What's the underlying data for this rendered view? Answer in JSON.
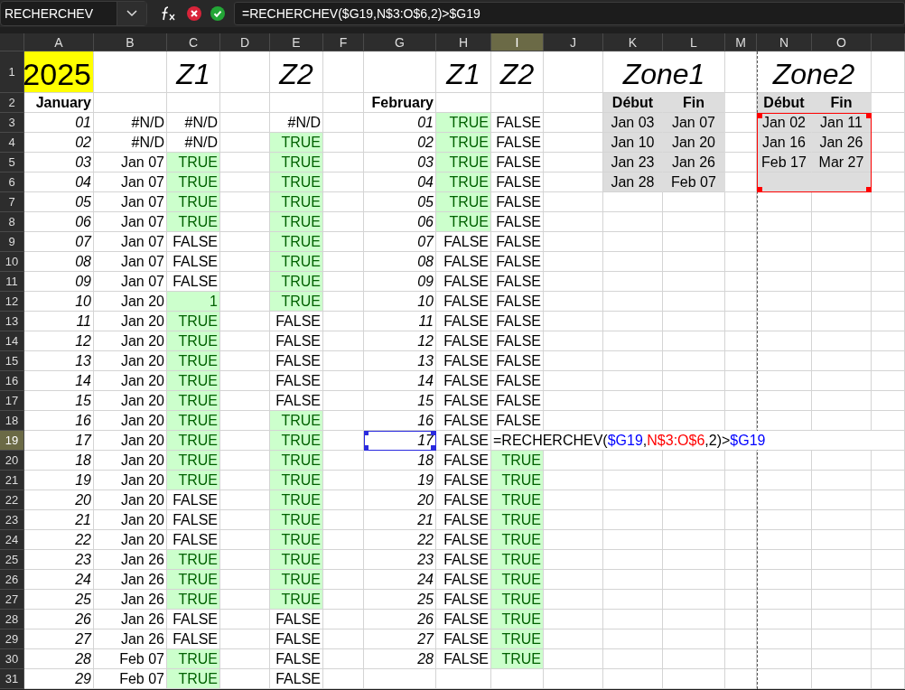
{
  "name_box": {
    "value": "RECHERCHEV"
  },
  "formula_bar": {
    "value": "=RECHERCHEV($G19,N$3:O$6,2)>$G19"
  },
  "columns": [
    {
      "label": "A",
      "selected": false,
      "page_break_before": false
    },
    {
      "label": "B",
      "selected": false,
      "page_break_before": false
    },
    {
      "label": "C",
      "selected": false,
      "page_break_before": false
    },
    {
      "label": "D",
      "selected": false,
      "page_break_before": false
    },
    {
      "label": "E",
      "selected": false,
      "page_break_before": false
    },
    {
      "label": "F",
      "selected": false,
      "page_break_before": false
    },
    {
      "label": "G",
      "selected": false,
      "page_break_before": false
    },
    {
      "label": "H",
      "selected": false,
      "page_break_before": false
    },
    {
      "label": "I",
      "selected": true,
      "page_break_before": false
    },
    {
      "label": "J",
      "selected": false,
      "page_break_before": false
    },
    {
      "label": "K",
      "selected": false,
      "page_break_before": false
    },
    {
      "label": "L",
      "selected": false,
      "page_break_before": false
    },
    {
      "label": "M",
      "selected": false,
      "page_break_before": false
    },
    {
      "label": "N",
      "selected": false,
      "page_break_before": true
    },
    {
      "label": "O",
      "selected": false,
      "page_break_before": false
    }
  ],
  "rows": [
    {
      "num": "1",
      "selected": false,
      "cells": [
        {
          "kind": "year",
          "text": "2025"
        },
        null,
        {
          "kind": "title",
          "text": "Z1"
        },
        null,
        {
          "kind": "title",
          "text": "Z2"
        },
        null,
        null,
        {
          "kind": "title",
          "text": "Z1"
        },
        {
          "kind": "title",
          "text": "Z2"
        },
        null,
        {
          "kind": "wide_title",
          "text": "Zone1"
        },
        null,
        null,
        {
          "kind": "wide_title",
          "text": "Zone2"
        },
        null
      ]
    },
    {
      "num": "2",
      "selected": false,
      "cells": [
        {
          "kind": "month",
          "text": "January"
        },
        null,
        null,
        null,
        null,
        null,
        {
          "kind": "month",
          "text": "February"
        },
        null,
        null,
        null,
        {
          "kind": "head",
          "text": "Début"
        },
        {
          "kind": "head",
          "text": "Fin"
        },
        null,
        {
          "kind": "head",
          "text": "Début"
        },
        {
          "kind": "head",
          "text": "Fin"
        }
      ]
    },
    {
      "num": "3",
      "selected": false,
      "cells": [
        {
          "kind": "day",
          "text": "01"
        },
        {
          "kind": "value",
          "text": "#N/D"
        },
        {
          "kind": "bool",
          "text": "#N/D",
          "highlighted": false
        },
        null,
        {
          "kind": "bool",
          "text": "#N/D",
          "highlighted": false
        },
        null,
        {
          "kind": "day",
          "text": "01"
        },
        {
          "kind": "bool",
          "text": "TRUE",
          "highlighted": true
        },
        {
          "kind": "bool",
          "text": "FALSE",
          "highlighted": false
        },
        null,
        {
          "kind": "range",
          "text": "Jan 03",
          "referenced": false
        },
        {
          "kind": "range",
          "text": "Jan 07",
          "referenced": false
        },
        null,
        {
          "kind": "range",
          "text": "Jan 02",
          "referenced": true
        },
        {
          "kind": "range",
          "text": "Jan 11",
          "referenced": true
        }
      ]
    },
    {
      "num": "4",
      "selected": false,
      "cells": [
        {
          "kind": "day",
          "text": "02"
        },
        {
          "kind": "value",
          "text": "#N/D"
        },
        {
          "kind": "bool",
          "text": "#N/D",
          "highlighted": false
        },
        null,
        {
          "kind": "bool",
          "text": "TRUE",
          "highlighted": true
        },
        null,
        {
          "kind": "day",
          "text": "02"
        },
        {
          "kind": "bool",
          "text": "TRUE",
          "highlighted": true
        },
        {
          "kind": "bool",
          "text": "FALSE",
          "highlighted": false
        },
        null,
        {
          "kind": "range",
          "text": "Jan 10",
          "referenced": false
        },
        {
          "kind": "range",
          "text": "Jan 20",
          "referenced": false
        },
        null,
        {
          "kind": "range",
          "text": "Jan 16",
          "referenced": true
        },
        {
          "kind": "range",
          "text": "Jan 26",
          "referenced": true
        }
      ]
    },
    {
      "num": "5",
      "selected": false,
      "cells": [
        {
          "kind": "day",
          "text": "03"
        },
        {
          "kind": "value",
          "text": "Jan 07"
        },
        {
          "kind": "bool",
          "text": "TRUE",
          "highlighted": true
        },
        null,
        {
          "kind": "bool",
          "text": "TRUE",
          "highlighted": true
        },
        null,
        {
          "kind": "day",
          "text": "03"
        },
        {
          "kind": "bool",
          "text": "TRUE",
          "highlighted": true
        },
        {
          "kind": "bool",
          "text": "FALSE",
          "highlighted": false
        },
        null,
        {
          "kind": "range",
          "text": "Jan 23",
          "referenced": false
        },
        {
          "kind": "range",
          "text": "Jan 26",
          "referenced": false
        },
        null,
        {
          "kind": "range",
          "text": "Feb 17",
          "referenced": true
        },
        {
          "kind": "range",
          "text": "Mar 27",
          "referenced": true
        }
      ]
    },
    {
      "num": "6",
      "selected": false,
      "cells": [
        {
          "kind": "day",
          "text": "04"
        },
        {
          "kind": "value",
          "text": "Jan 07"
        },
        {
          "kind": "bool",
          "text": "TRUE",
          "highlighted": true
        },
        null,
        {
          "kind": "bool",
          "text": "TRUE",
          "highlighted": true
        },
        null,
        {
          "kind": "day",
          "text": "04"
        },
        {
          "kind": "bool",
          "text": "TRUE",
          "highlighted": true
        },
        {
          "kind": "bool",
          "text": "FALSE",
          "highlighted": false
        },
        null,
        {
          "kind": "range",
          "text": "Jan 28",
          "referenced": false
        },
        {
          "kind": "range",
          "text": "Feb 07",
          "referenced": false
        },
        null,
        {
          "kind": "range",
          "referenced": true
        },
        {
          "kind": "range",
          "referenced": true
        }
      ]
    },
    {
      "num": "7",
      "selected": false,
      "cells": [
        {
          "kind": "day",
          "text": "05"
        },
        {
          "kind": "value",
          "text": "Jan 07"
        },
        {
          "kind": "bool",
          "text": "TRUE",
          "highlighted": true
        },
        null,
        {
          "kind": "bool",
          "text": "TRUE",
          "highlighted": true
        },
        null,
        {
          "kind": "day",
          "text": "05"
        },
        {
          "kind": "bool",
          "text": "TRUE",
          "highlighted": true
        },
        {
          "kind": "bool",
          "text": "FALSE",
          "highlighted": false
        }
      ]
    },
    {
      "num": "8",
      "selected": false,
      "cells": [
        {
          "kind": "day",
          "text": "06"
        },
        {
          "kind": "value",
          "text": "Jan 07"
        },
        {
          "kind": "bool",
          "text": "TRUE",
          "highlighted": true
        },
        null,
        {
          "kind": "bool",
          "text": "TRUE",
          "highlighted": true
        },
        null,
        {
          "kind": "day",
          "text": "06"
        },
        {
          "kind": "bool",
          "text": "TRUE",
          "highlighted": true
        },
        {
          "kind": "bool",
          "text": "FALSE",
          "highlighted": false
        }
      ]
    },
    {
      "num": "9",
      "selected": false,
      "cells": [
        {
          "kind": "day",
          "text": "07"
        },
        {
          "kind": "value",
          "text": "Jan 07"
        },
        {
          "kind": "bool",
          "text": "FALSE",
          "highlighted": false
        },
        null,
        {
          "kind": "bool",
          "text": "TRUE",
          "highlighted": true
        },
        null,
        {
          "kind": "day",
          "text": "07"
        },
        {
          "kind": "bool",
          "text": "FALSE",
          "highlighted": false
        },
        {
          "kind": "bool",
          "text": "FALSE",
          "highlighted": false
        }
      ]
    },
    {
      "num": "10",
      "selected": false,
      "cells": [
        {
          "kind": "day",
          "text": "08"
        },
        {
          "kind": "value",
          "text": "Jan 07"
        },
        {
          "kind": "bool",
          "text": "FALSE",
          "highlighted": false
        },
        null,
        {
          "kind": "bool",
          "text": "TRUE",
          "highlighted": true
        },
        null,
        {
          "kind": "day",
          "text": "08"
        },
        {
          "kind": "bool",
          "text": "FALSE",
          "highlighted": false
        },
        {
          "kind": "bool",
          "text": "FALSE",
          "highlighted": false
        }
      ]
    },
    {
      "num": "11",
      "selected": false,
      "cells": [
        {
          "kind": "day",
          "text": "09"
        },
        {
          "kind": "value",
          "text": "Jan 07"
        },
        {
          "kind": "bool",
          "text": "FALSE",
          "highlighted": false
        },
        null,
        {
          "kind": "bool",
          "text": "TRUE",
          "highlighted": true
        },
        null,
        {
          "kind": "day",
          "text": "09"
        },
        {
          "kind": "bool",
          "text": "FALSE",
          "highlighted": false
        },
        {
          "kind": "bool",
          "text": "FALSE",
          "highlighted": false
        }
      ]
    },
    {
      "num": "12",
      "selected": false,
      "cells": [
        {
          "kind": "day",
          "text": "10"
        },
        {
          "kind": "value",
          "text": "Jan 20"
        },
        {
          "kind": "bool",
          "text": "1",
          "highlighted": true
        },
        null,
        {
          "kind": "bool",
          "text": "TRUE",
          "highlighted": true
        },
        null,
        {
          "kind": "day",
          "text": "10"
        },
        {
          "kind": "bool",
          "text": "FALSE",
          "highlighted": false
        },
        {
          "kind": "bool",
          "text": "FALSE",
          "highlighted": false
        }
      ]
    },
    {
      "num": "13",
      "selected": false,
      "cells": [
        {
          "kind": "day",
          "text": "11"
        },
        {
          "kind": "value",
          "text": "Jan 20"
        },
        {
          "kind": "bool",
          "text": "TRUE",
          "highlighted": true
        },
        null,
        {
          "kind": "bool",
          "text": "FALSE",
          "highlighted": false
        },
        null,
        {
          "kind": "day",
          "text": "11"
        },
        {
          "kind": "bool",
          "text": "FALSE",
          "highlighted": false
        },
        {
          "kind": "bool",
          "text": "FALSE",
          "highlighted": false
        }
      ]
    },
    {
      "num": "14",
      "selected": false,
      "cells": [
        {
          "kind": "day",
          "text": "12"
        },
        {
          "kind": "value",
          "text": "Jan 20"
        },
        {
          "kind": "bool",
          "text": "TRUE",
          "highlighted": true
        },
        null,
        {
          "kind": "bool",
          "text": "FALSE",
          "highlighted": false
        },
        null,
        {
          "kind": "day",
          "text": "12"
        },
        {
          "kind": "bool",
          "text": "FALSE",
          "highlighted": false
        },
        {
          "kind": "bool",
          "text": "FALSE",
          "highlighted": false
        }
      ]
    },
    {
      "num": "15",
      "selected": false,
      "cells": [
        {
          "kind": "day",
          "text": "13"
        },
        {
          "kind": "value",
          "text": "Jan 20"
        },
        {
          "kind": "bool",
          "text": "TRUE",
          "highlighted": true
        },
        null,
        {
          "kind": "bool",
          "text": "FALSE",
          "highlighted": false
        },
        null,
        {
          "kind": "day",
          "text": "13"
        },
        {
          "kind": "bool",
          "text": "FALSE",
          "highlighted": false
        },
        {
          "kind": "bool",
          "text": "FALSE",
          "highlighted": false
        }
      ]
    },
    {
      "num": "16",
      "selected": false,
      "cells": [
        {
          "kind": "day",
          "text": "14"
        },
        {
          "kind": "value",
          "text": "Jan 20"
        },
        {
          "kind": "bool",
          "text": "TRUE",
          "highlighted": true
        },
        null,
        {
          "kind": "bool",
          "text": "FALSE",
          "highlighted": false
        },
        null,
        {
          "kind": "day",
          "text": "14"
        },
        {
          "kind": "bool",
          "text": "FALSE",
          "highlighted": false
        },
        {
          "kind": "bool",
          "text": "FALSE",
          "highlighted": false
        }
      ]
    },
    {
      "num": "17",
      "selected": false,
      "cells": [
        {
          "kind": "day",
          "text": "15"
        },
        {
          "kind": "value",
          "text": "Jan 20"
        },
        {
          "kind": "bool",
          "text": "TRUE",
          "highlighted": true
        },
        null,
        {
          "kind": "bool",
          "text": "FALSE",
          "highlighted": false
        },
        null,
        {
          "kind": "day",
          "text": "15"
        },
        {
          "kind": "bool",
          "text": "FALSE",
          "highlighted": false
        },
        {
          "kind": "bool",
          "text": "FALSE",
          "highlighted": false
        }
      ]
    },
    {
      "num": "18",
      "selected": false,
      "cells": [
        {
          "kind": "day",
          "text": "16"
        },
        {
          "kind": "value",
          "text": "Jan 20"
        },
        {
          "kind": "bool",
          "text": "TRUE",
          "highlighted": true
        },
        null,
        {
          "kind": "bool",
          "text": "TRUE",
          "highlighted": true
        },
        null,
        {
          "kind": "day",
          "text": "16"
        },
        {
          "kind": "bool",
          "text": "FALSE",
          "highlighted": false
        },
        {
          "kind": "bool",
          "text": "FALSE",
          "highlighted": false
        }
      ]
    },
    {
      "num": "19",
      "selected": true,
      "cells": [
        {
          "kind": "day",
          "text": "17"
        },
        {
          "kind": "value",
          "text": "Jan 20"
        },
        {
          "kind": "bool",
          "text": "TRUE",
          "highlighted": true
        },
        null,
        {
          "kind": "bool",
          "text": "TRUE",
          "highlighted": true
        },
        null,
        {
          "kind": "day",
          "text": "17",
          "selected": true
        },
        {
          "kind": "bool",
          "text": "FALSE",
          "highlighted": false
        },
        {
          "kind": "editor",
          "parts": [
            {
              "text": "=RECHERCHEV("
            },
            {
              "text": "$G19",
              "color": "#0000ff"
            },
            {
              "text": ","
            },
            {
              "text": "N$3:O$6",
              "color": "#ff0000"
            },
            {
              "text": ",2)>"
            },
            {
              "text": "$G19",
              "color": "#0000ff"
            }
          ]
        }
      ]
    },
    {
      "num": "20",
      "selected": false,
      "cells": [
        {
          "kind": "day",
          "text": "18"
        },
        {
          "kind": "value",
          "text": "Jan 20"
        },
        {
          "kind": "bool",
          "text": "TRUE",
          "highlighted": true
        },
        null,
        {
          "kind": "bool",
          "text": "TRUE",
          "highlighted": true
        },
        null,
        {
          "kind": "day",
          "text": "18"
        },
        {
          "kind": "bool",
          "text": "FALSE",
          "highlighted": false
        },
        {
          "kind": "bool",
          "text": "TRUE",
          "highlighted": true
        }
      ]
    },
    {
      "num": "21",
      "selected": false,
      "cells": [
        {
          "kind": "day",
          "text": "19"
        },
        {
          "kind": "value",
          "text": "Jan 20"
        },
        {
          "kind": "bool",
          "text": "TRUE",
          "highlighted": true
        },
        null,
        {
          "kind": "bool",
          "text": "TRUE",
          "highlighted": true
        },
        null,
        {
          "kind": "day",
          "text": "19"
        },
        {
          "kind": "bool",
          "text": "FALSE",
          "highlighted": false
        },
        {
          "kind": "bool",
          "text": "TRUE",
          "highlighted": true
        }
      ]
    },
    {
      "num": "22",
      "selected": false,
      "cells": [
        {
          "kind": "day",
          "text": "20"
        },
        {
          "kind": "value",
          "text": "Jan 20"
        },
        {
          "kind": "bool",
          "text": "FALSE",
          "highlighted": false
        },
        null,
        {
          "kind": "bool",
          "text": "TRUE",
          "highlighted": true
        },
        null,
        {
          "kind": "day",
          "text": "20"
        },
        {
          "kind": "bool",
          "text": "FALSE",
          "highlighted": false
        },
        {
          "kind": "bool",
          "text": "TRUE",
          "highlighted": true
        }
      ]
    },
    {
      "num": "23",
      "selected": false,
      "cells": [
        {
          "kind": "day",
          "text": "21"
        },
        {
          "kind": "value",
          "text": "Jan 20"
        },
        {
          "kind": "bool",
          "text": "FALSE",
          "highlighted": false
        },
        null,
        {
          "kind": "bool",
          "text": "TRUE",
          "highlighted": true
        },
        null,
        {
          "kind": "day",
          "text": "21"
        },
        {
          "kind": "bool",
          "text": "FALSE",
          "highlighted": false
        },
        {
          "kind": "bool",
          "text": "TRUE",
          "highlighted": true
        }
      ]
    },
    {
      "num": "24",
      "selected": false,
      "cells": [
        {
          "kind": "day",
          "text": "22"
        },
        {
          "kind": "value",
          "text": "Jan 20"
        },
        {
          "kind": "bool",
          "text": "FALSE",
          "highlighted": false
        },
        null,
        {
          "kind": "bool",
          "text": "TRUE",
          "highlighted": true
        },
        null,
        {
          "kind": "day",
          "text": "22"
        },
        {
          "kind": "bool",
          "text": "FALSE",
          "highlighted": false
        },
        {
          "kind": "bool",
          "text": "TRUE",
          "highlighted": true
        }
      ]
    },
    {
      "num": "25",
      "selected": false,
      "cells": [
        {
          "kind": "day",
          "text": "23"
        },
        {
          "kind": "value",
          "text": "Jan 26"
        },
        {
          "kind": "bool",
          "text": "TRUE",
          "highlighted": true
        },
        null,
        {
          "kind": "bool",
          "text": "TRUE",
          "highlighted": true
        },
        null,
        {
          "kind": "day",
          "text": "23"
        },
        {
          "kind": "bool",
          "text": "FALSE",
          "highlighted": false
        },
        {
          "kind": "bool",
          "text": "TRUE",
          "highlighted": true
        }
      ]
    },
    {
      "num": "26",
      "selected": false,
      "cells": [
        {
          "kind": "day",
          "text": "24"
        },
        {
          "kind": "value",
          "text": "Jan 26"
        },
        {
          "kind": "bool",
          "text": "TRUE",
          "highlighted": true
        },
        null,
        {
          "kind": "bool",
          "text": "TRUE",
          "highlighted": true
        },
        null,
        {
          "kind": "day",
          "text": "24"
        },
        {
          "kind": "bool",
          "text": "FALSE",
          "highlighted": false
        },
        {
          "kind": "bool",
          "text": "TRUE",
          "highlighted": true
        }
      ]
    },
    {
      "num": "27",
      "selected": false,
      "cells": [
        {
          "kind": "day",
          "text": "25"
        },
        {
          "kind": "value",
          "text": "Jan 26"
        },
        {
          "kind": "bool",
          "text": "TRUE",
          "highlighted": true
        },
        null,
        {
          "kind": "bool",
          "text": "TRUE",
          "highlighted": true
        },
        null,
        {
          "kind": "day",
          "text": "25"
        },
        {
          "kind": "bool",
          "text": "FALSE",
          "highlighted": false
        },
        {
          "kind": "bool",
          "text": "TRUE",
          "highlighted": true
        }
      ]
    },
    {
      "num": "28",
      "selected": false,
      "cells": [
        {
          "kind": "day",
          "text": "26"
        },
        {
          "kind": "value",
          "text": "Jan 26"
        },
        {
          "kind": "bool",
          "text": "FALSE",
          "highlighted": false
        },
        null,
        {
          "kind": "bool",
          "text": "FALSE",
          "highlighted": false
        },
        null,
        {
          "kind": "day",
          "text": "26"
        },
        {
          "kind": "bool",
          "text": "FALSE",
          "highlighted": false
        },
        {
          "kind": "bool",
          "text": "TRUE",
          "highlighted": true
        }
      ]
    },
    {
      "num": "29",
      "selected": false,
      "cells": [
        {
          "kind": "day",
          "text": "27"
        },
        {
          "kind": "value",
          "text": "Jan 26"
        },
        {
          "kind": "bool",
          "text": "FALSE",
          "highlighted": false
        },
        null,
        {
          "kind": "bool",
          "text": "FALSE",
          "highlighted": false
        },
        null,
        {
          "kind": "day",
          "text": "27"
        },
        {
          "kind": "bool",
          "text": "FALSE",
          "highlighted": false
        },
        {
          "kind": "bool",
          "text": "TRUE",
          "highlighted": true
        }
      ]
    },
    {
      "num": "30",
      "selected": false,
      "cells": [
        {
          "kind": "day",
          "text": "28"
        },
        {
          "kind": "value",
          "text": "Feb 07"
        },
        {
          "kind": "bool",
          "text": "TRUE",
          "highlighted": true
        },
        null,
        {
          "kind": "bool",
          "text": "FALSE",
          "highlighted": false
        },
        null,
        {
          "kind": "day",
          "text": "28"
        },
        {
          "kind": "bool",
          "text": "FALSE",
          "highlighted": false
        },
        {
          "kind": "bool",
          "text": "TRUE",
          "highlighted": true
        }
      ]
    },
    {
      "num": "31",
      "selected": false,
      "cells": [
        {
          "kind": "day",
          "text": "29"
        },
        {
          "kind": "value",
          "text": "Feb 07"
        },
        {
          "kind": "bool",
          "text": "TRUE",
          "highlighted": true
        },
        null,
        {
          "kind": "bool",
          "text": "FALSE",
          "highlighted": false
        }
      ]
    }
  ]
}
